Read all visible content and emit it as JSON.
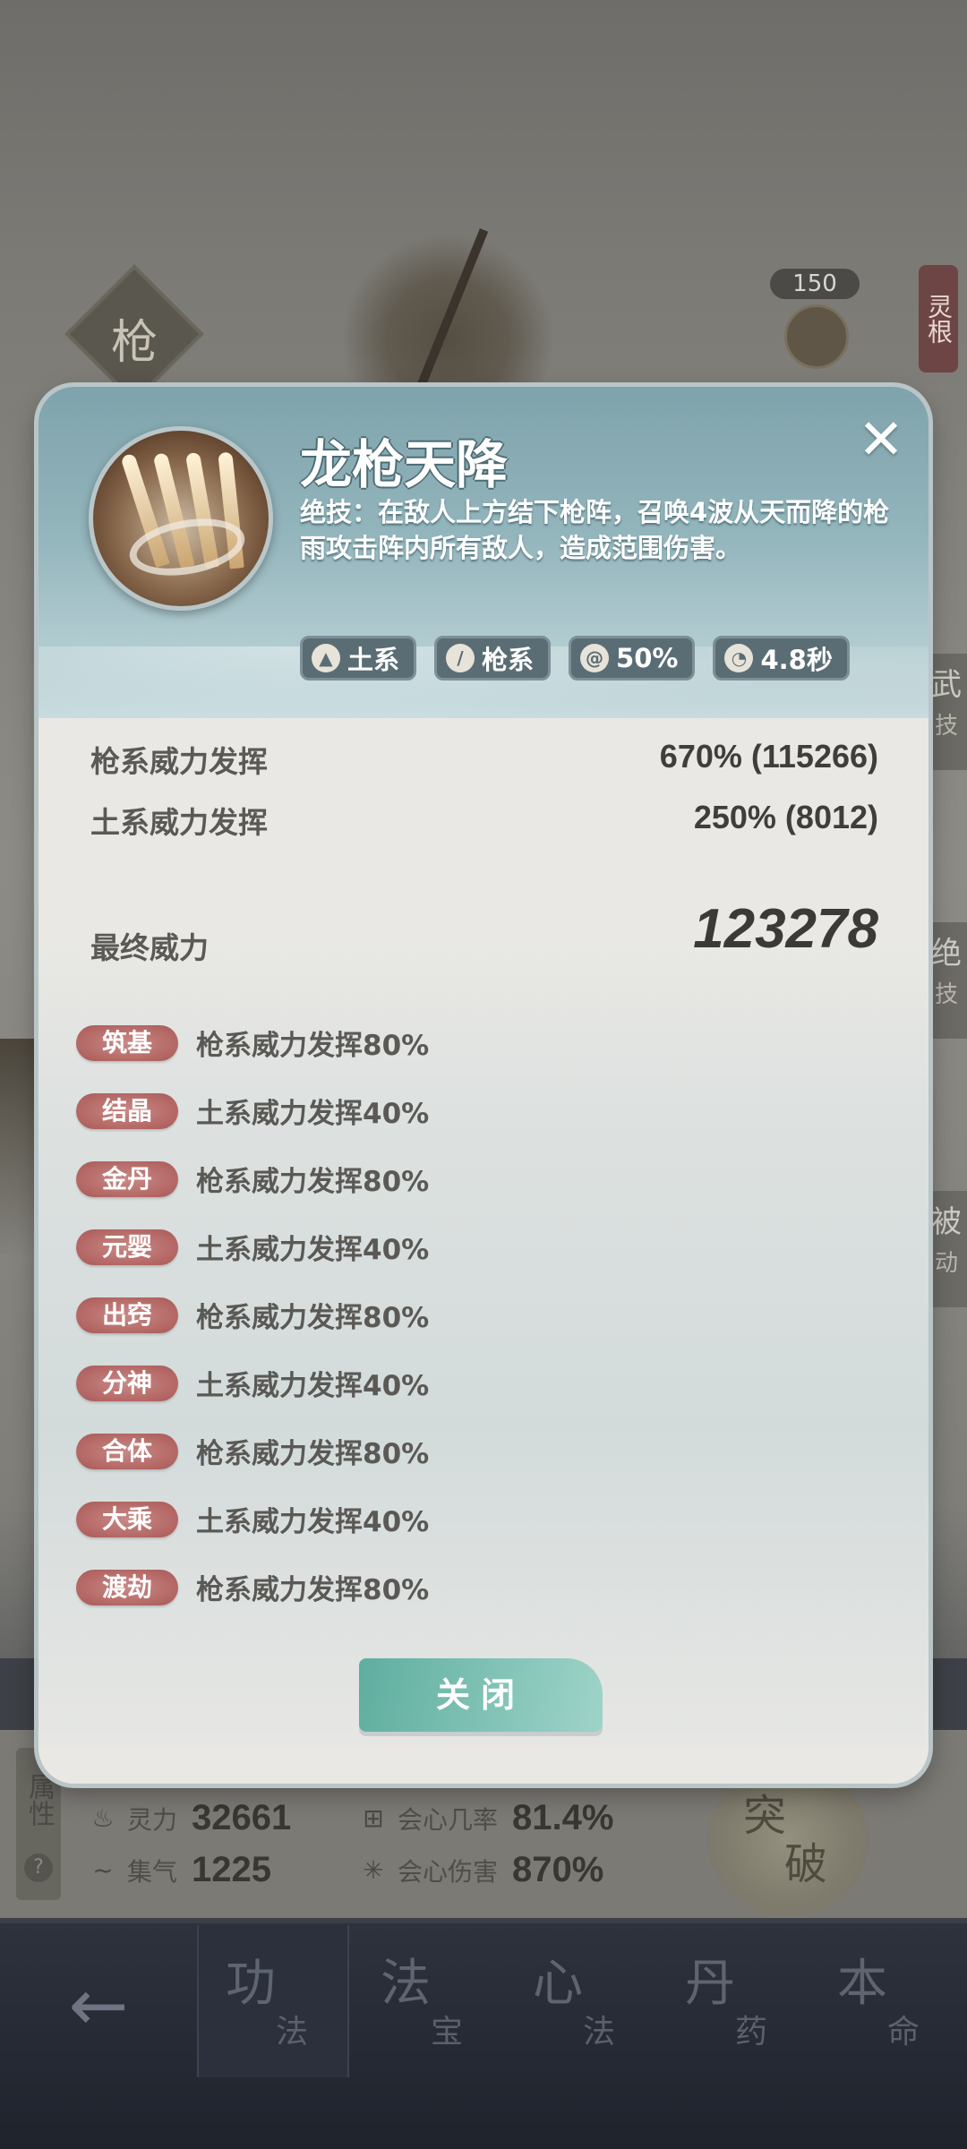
{
  "background": {
    "weapon_badge": "枪",
    "level": "150",
    "linggen_tab": "灵根",
    "side_tabs": [
      {
        "main": "武",
        "sub": "技"
      },
      {
        "main": "绝",
        "sub": "技"
      },
      {
        "main": "被",
        "sub": "动"
      }
    ],
    "attributes": {
      "side_label": "属性",
      "help": "?",
      "rows": [
        {
          "icon": "flame-icon",
          "label": "灵力",
          "value": "32661"
        },
        {
          "icon": "crit-icon",
          "label": "会心几率",
          "value": "81.4%"
        },
        {
          "icon": "swirl-icon",
          "label": "集气",
          "value": "1225"
        },
        {
          "icon": "burst-icon",
          "label": "会心伤害",
          "value": "870%"
        }
      ],
      "break_badge": [
        "突",
        "破"
      ]
    },
    "bottom_nav": {
      "back_icon": "back-arrow-icon",
      "items": [
        {
          "main": "功",
          "sub": "法"
        },
        {
          "main": "法",
          "sub": "宝"
        },
        {
          "main": "心",
          "sub": "法"
        },
        {
          "main": "丹",
          "sub": "药"
        },
        {
          "main": "本",
          "sub": "命"
        }
      ]
    }
  },
  "modal": {
    "skill_name": "龙枪天降",
    "description": "绝技：在敌人上方结下枪阵，召唤4波从天而降的枪雨攻击阵内所有敌人，造成范围伤害。",
    "close_icon": "close-icon",
    "tags": [
      {
        "icon": "earth-icon",
        "label": "土系"
      },
      {
        "icon": "spear-icon",
        "label": "枪系"
      },
      {
        "icon": "vortex-icon",
        "label": "50%"
      },
      {
        "icon": "cooldown-icon",
        "label": "4.8秒"
      }
    ],
    "stats": [
      {
        "label": "枪系威力发挥",
        "value": "670% (115266)"
      },
      {
        "label": "土系威力发挥",
        "value": "250% (8012)"
      }
    ],
    "final_label": "最终威力",
    "final_value": "123278",
    "realms": [
      {
        "badge": "筑基",
        "text": "枪系威力发挥80%"
      },
      {
        "badge": "结晶",
        "text": "土系威力发挥40%"
      },
      {
        "badge": "金丹",
        "text": "枪系威力发挥80%"
      },
      {
        "badge": "元婴",
        "text": "土系威力发挥40%"
      },
      {
        "badge": "出窍",
        "text": "枪系威力发挥80%"
      },
      {
        "badge": "分神",
        "text": "土系威力发挥40%"
      },
      {
        "badge": "合体",
        "text": "枪系威力发挥80%"
      },
      {
        "badge": "大乘",
        "text": "土系威力发挥40%"
      },
      {
        "badge": "渡劫",
        "text": "枪系威力发挥80%"
      }
    ],
    "close_button": "关闭"
  }
}
